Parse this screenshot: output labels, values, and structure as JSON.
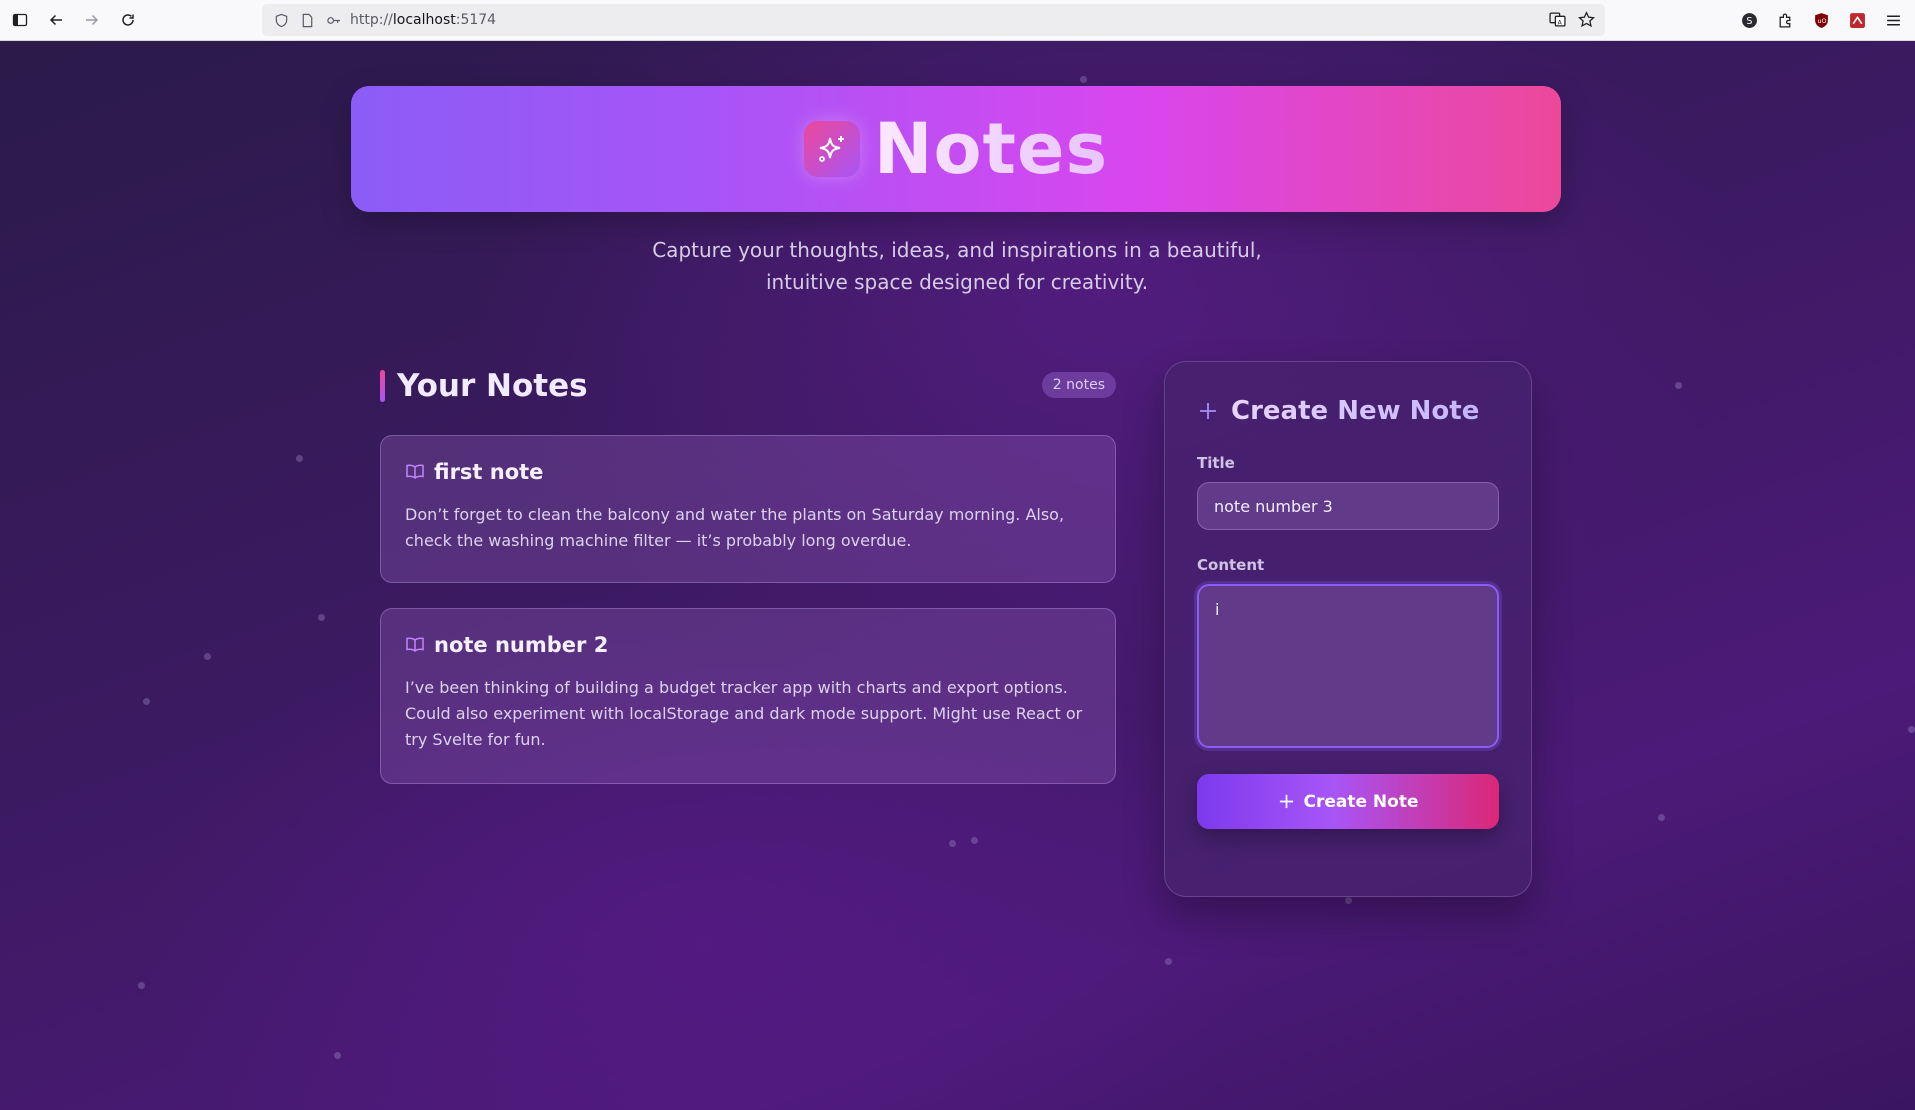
{
  "browser": {
    "url_scheme": "http://",
    "url_host": "localhost",
    "url_port": ":5174"
  },
  "hero": {
    "title": "Notes",
    "icon": "sparkles-icon"
  },
  "subtitle": {
    "line1": "Capture your thoughts, ideas, and inspirations in a beautiful,",
    "line2": "intuitive space designed for creativity."
  },
  "notes_section": {
    "title": "Your Notes",
    "count_label": "2 notes",
    "notes": [
      {
        "title": "first note",
        "content": "Don’t forget to clean the balcony and water the plants on Saturday morning. Also, check the washing machine filter — it’s probably long overdue."
      },
      {
        "title": "note number 2",
        "content": "I’ve been thinking of building a budget tracker app with charts and export options. Could also experiment with localStorage and dark mode support. Might use React or try Svelte for fun."
      }
    ]
  },
  "create_form": {
    "heading": "Create New Note",
    "title_label": "Title",
    "title_value": "note number 3",
    "content_label": "Content",
    "content_value": "i",
    "submit_label": "Create Note"
  },
  "colors": {
    "hero_gradient_start": "#8b5cf6",
    "hero_gradient_end": "#ec4899",
    "accent": "#a855f7",
    "background": "#3d1a63"
  }
}
